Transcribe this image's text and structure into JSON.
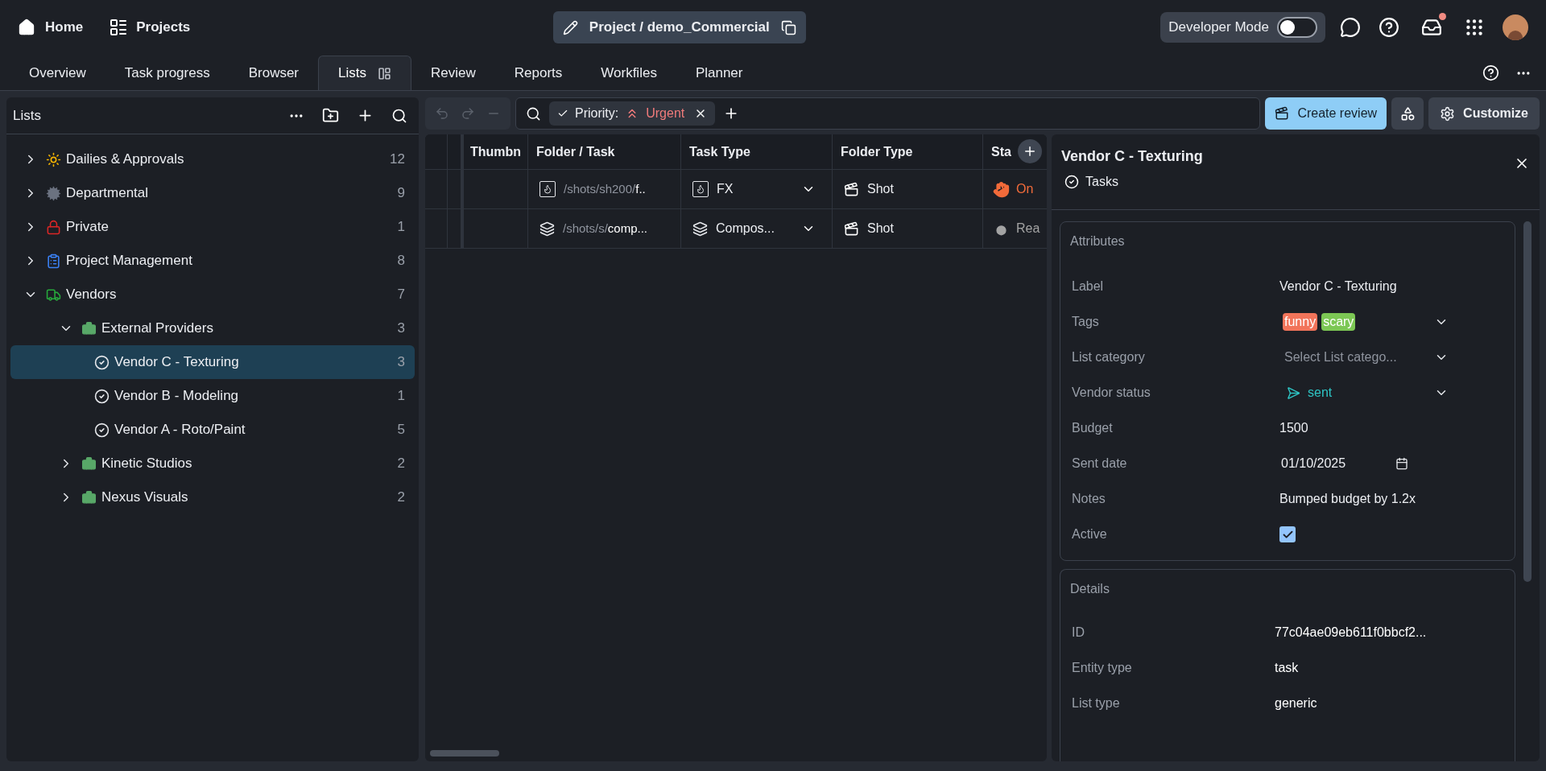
{
  "topbar": {
    "home": "Home",
    "projects": "Projects",
    "project": "Project / demo_Commercial",
    "developer_mode": {
      "label": "Developer Mode",
      "on": false
    },
    "inbox_unread": true
  },
  "tabs": [
    {
      "label": "Overview",
      "selected": false
    },
    {
      "label": "Task progress",
      "selected": false
    },
    {
      "label": "Browser",
      "selected": false
    },
    {
      "label": "Lists",
      "selected": true
    },
    {
      "label": "Review",
      "selected": false
    },
    {
      "label": "Reports",
      "selected": false
    },
    {
      "label": "Workfiles",
      "selected": false
    },
    {
      "label": "Planner",
      "selected": false
    }
  ],
  "sidebar": {
    "title": "Lists",
    "items": [
      {
        "kind": "folder",
        "label": "Dailies & Approvals",
        "count": "12",
        "color": "#f5b400",
        "expanded": false,
        "selected": false
      },
      {
        "kind": "folder",
        "label": "Departmental",
        "count": "9",
        "color": "#6b7280",
        "expanded": false,
        "selected": false
      },
      {
        "kind": "folder",
        "label": "Private",
        "count": "1",
        "color": "#dc2626",
        "expanded": false,
        "selected": false
      },
      {
        "kind": "folder",
        "label": "Project Management",
        "count": "8",
        "color": "#3b82f6",
        "expanded": false,
        "selected": false
      },
      {
        "kind": "folder",
        "label": "Vendors",
        "count": "7",
        "color": "#27a83c",
        "expanded": true,
        "selected": false,
        "children": [
          {
            "kind": "folder",
            "label": "External Providers",
            "count": "3",
            "color": "#58a868",
            "expanded": true,
            "selected": false,
            "children": [
              {
                "kind": "list",
                "label": "Vendor C - Texturing",
                "count": "3",
                "selected": true
              },
              {
                "kind": "list",
                "label": "Vendor B - Modeling",
                "count": "1",
                "selected": false
              },
              {
                "kind": "list",
                "label": "Vendor A - Roto/Paint",
                "count": "5",
                "selected": false
              }
            ]
          },
          {
            "kind": "folder",
            "label": "Kinetic Studios",
            "count": "2",
            "color": "#58a868",
            "expanded": false,
            "selected": false
          },
          {
            "kind": "folder",
            "label": "Nexus Visuals",
            "count": "2",
            "color": "#58a868",
            "expanded": false,
            "selected": false
          }
        ]
      }
    ]
  },
  "toolbar": {
    "filter": {
      "label": "Priority:",
      "value": "Urgent"
    },
    "create_review": "Create review",
    "customize": "Customize"
  },
  "table": {
    "columns": [
      "Thumbn",
      "Folder / Task",
      "Task Type",
      "Folder Type",
      "Sta"
    ],
    "rows": [
      {
        "kind": "fx",
        "path": "/shots/sh200/",
        "name": "f..",
        "task_type": "FX",
        "folder_type": "Shot",
        "status": {
          "kind": "on-hold",
          "label": "On",
          "color": "#f26b3a"
        }
      },
      {
        "kind": "compositing",
        "path": "/shots/s/",
        "name": "comp...",
        "task_type": "Compos...",
        "folder_type": "Shot",
        "status": {
          "kind": "ready",
          "label": "Rea",
          "color": "#a3a3a3"
        }
      }
    ]
  },
  "details": {
    "title": "Vendor C - Texturing",
    "subtitle": "Tasks",
    "attributes": {
      "title": "Attributes",
      "rows": [
        {
          "kind": "text",
          "label": "Label",
          "value": "Vendor C - Texturing"
        },
        {
          "kind": "tags",
          "label": "Tags",
          "tags": [
            {
              "label": "funny",
              "color": "#f2745a"
            },
            {
              "label": "scary",
              "color": "#7cc754"
            }
          ]
        },
        {
          "kind": "select",
          "label": "List category",
          "placeholder": "Select List catego..."
        },
        {
          "kind": "status",
          "label": "Vendor status",
          "value": "sent"
        },
        {
          "kind": "text",
          "label": "Budget",
          "value": "1500"
        },
        {
          "kind": "date",
          "label": "Sent date",
          "value": "01/10/2025"
        },
        {
          "kind": "text",
          "label": "Notes",
          "value": "Bumped budget by 1.2x"
        },
        {
          "kind": "checkbox",
          "label": "Active",
          "checked": true
        }
      ]
    },
    "info": {
      "title": "Details",
      "rows": [
        {
          "label": "ID",
          "value": "77c04ae09eb611f0bbcf2..."
        },
        {
          "label": "Entity type",
          "value": "task"
        },
        {
          "label": "List type",
          "value": "generic"
        }
      ]
    }
  }
}
